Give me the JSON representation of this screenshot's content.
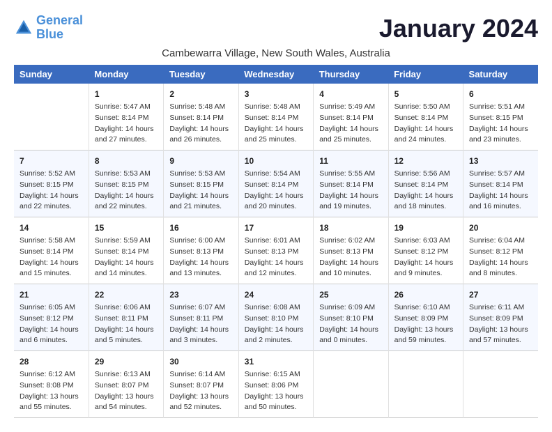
{
  "header": {
    "logo_line1": "General",
    "logo_line2": "Blue",
    "month_year": "January 2024",
    "location": "Cambewarra Village, New South Wales, Australia"
  },
  "days_of_week": [
    "Sunday",
    "Monday",
    "Tuesday",
    "Wednesday",
    "Thursday",
    "Friday",
    "Saturday"
  ],
  "weeks": [
    [
      {
        "day": "",
        "content": ""
      },
      {
        "day": "1",
        "content": "Sunrise: 5:47 AM\nSunset: 8:14 PM\nDaylight: 14 hours\nand 27 minutes."
      },
      {
        "day": "2",
        "content": "Sunrise: 5:48 AM\nSunset: 8:14 PM\nDaylight: 14 hours\nand 26 minutes."
      },
      {
        "day": "3",
        "content": "Sunrise: 5:48 AM\nSunset: 8:14 PM\nDaylight: 14 hours\nand 25 minutes."
      },
      {
        "day": "4",
        "content": "Sunrise: 5:49 AM\nSunset: 8:14 PM\nDaylight: 14 hours\nand 25 minutes."
      },
      {
        "day": "5",
        "content": "Sunrise: 5:50 AM\nSunset: 8:14 PM\nDaylight: 14 hours\nand 24 minutes."
      },
      {
        "day": "6",
        "content": "Sunrise: 5:51 AM\nSunset: 8:15 PM\nDaylight: 14 hours\nand 23 minutes."
      }
    ],
    [
      {
        "day": "7",
        "content": "Sunrise: 5:52 AM\nSunset: 8:15 PM\nDaylight: 14 hours\nand 22 minutes."
      },
      {
        "day": "8",
        "content": "Sunrise: 5:53 AM\nSunset: 8:15 PM\nDaylight: 14 hours\nand 22 minutes."
      },
      {
        "day": "9",
        "content": "Sunrise: 5:53 AM\nSunset: 8:15 PM\nDaylight: 14 hours\nand 21 minutes."
      },
      {
        "day": "10",
        "content": "Sunrise: 5:54 AM\nSunset: 8:14 PM\nDaylight: 14 hours\nand 20 minutes."
      },
      {
        "day": "11",
        "content": "Sunrise: 5:55 AM\nSunset: 8:14 PM\nDaylight: 14 hours\nand 19 minutes."
      },
      {
        "day": "12",
        "content": "Sunrise: 5:56 AM\nSunset: 8:14 PM\nDaylight: 14 hours\nand 18 minutes."
      },
      {
        "day": "13",
        "content": "Sunrise: 5:57 AM\nSunset: 8:14 PM\nDaylight: 14 hours\nand 16 minutes."
      }
    ],
    [
      {
        "day": "14",
        "content": "Sunrise: 5:58 AM\nSunset: 8:14 PM\nDaylight: 14 hours\nand 15 minutes."
      },
      {
        "day": "15",
        "content": "Sunrise: 5:59 AM\nSunset: 8:14 PM\nDaylight: 14 hours\nand 14 minutes."
      },
      {
        "day": "16",
        "content": "Sunrise: 6:00 AM\nSunset: 8:13 PM\nDaylight: 14 hours\nand 13 minutes."
      },
      {
        "day": "17",
        "content": "Sunrise: 6:01 AM\nSunset: 8:13 PM\nDaylight: 14 hours\nand 12 minutes."
      },
      {
        "day": "18",
        "content": "Sunrise: 6:02 AM\nSunset: 8:13 PM\nDaylight: 14 hours\nand 10 minutes."
      },
      {
        "day": "19",
        "content": "Sunrise: 6:03 AM\nSunset: 8:12 PM\nDaylight: 14 hours\nand 9 minutes."
      },
      {
        "day": "20",
        "content": "Sunrise: 6:04 AM\nSunset: 8:12 PM\nDaylight: 14 hours\nand 8 minutes."
      }
    ],
    [
      {
        "day": "21",
        "content": "Sunrise: 6:05 AM\nSunset: 8:12 PM\nDaylight: 14 hours\nand 6 minutes."
      },
      {
        "day": "22",
        "content": "Sunrise: 6:06 AM\nSunset: 8:11 PM\nDaylight: 14 hours\nand 5 minutes."
      },
      {
        "day": "23",
        "content": "Sunrise: 6:07 AM\nSunset: 8:11 PM\nDaylight: 14 hours\nand 3 minutes."
      },
      {
        "day": "24",
        "content": "Sunrise: 6:08 AM\nSunset: 8:10 PM\nDaylight: 14 hours\nand 2 minutes."
      },
      {
        "day": "25",
        "content": "Sunrise: 6:09 AM\nSunset: 8:10 PM\nDaylight: 14 hours\nand 0 minutes."
      },
      {
        "day": "26",
        "content": "Sunrise: 6:10 AM\nSunset: 8:09 PM\nDaylight: 13 hours\nand 59 minutes."
      },
      {
        "day": "27",
        "content": "Sunrise: 6:11 AM\nSunset: 8:09 PM\nDaylight: 13 hours\nand 57 minutes."
      }
    ],
    [
      {
        "day": "28",
        "content": "Sunrise: 6:12 AM\nSunset: 8:08 PM\nDaylight: 13 hours\nand 55 minutes."
      },
      {
        "day": "29",
        "content": "Sunrise: 6:13 AM\nSunset: 8:07 PM\nDaylight: 13 hours\nand 54 minutes."
      },
      {
        "day": "30",
        "content": "Sunrise: 6:14 AM\nSunset: 8:07 PM\nDaylight: 13 hours\nand 52 minutes."
      },
      {
        "day": "31",
        "content": "Sunrise: 6:15 AM\nSunset: 8:06 PM\nDaylight: 13 hours\nand 50 minutes."
      },
      {
        "day": "",
        "content": ""
      },
      {
        "day": "",
        "content": ""
      },
      {
        "day": "",
        "content": ""
      }
    ]
  ]
}
